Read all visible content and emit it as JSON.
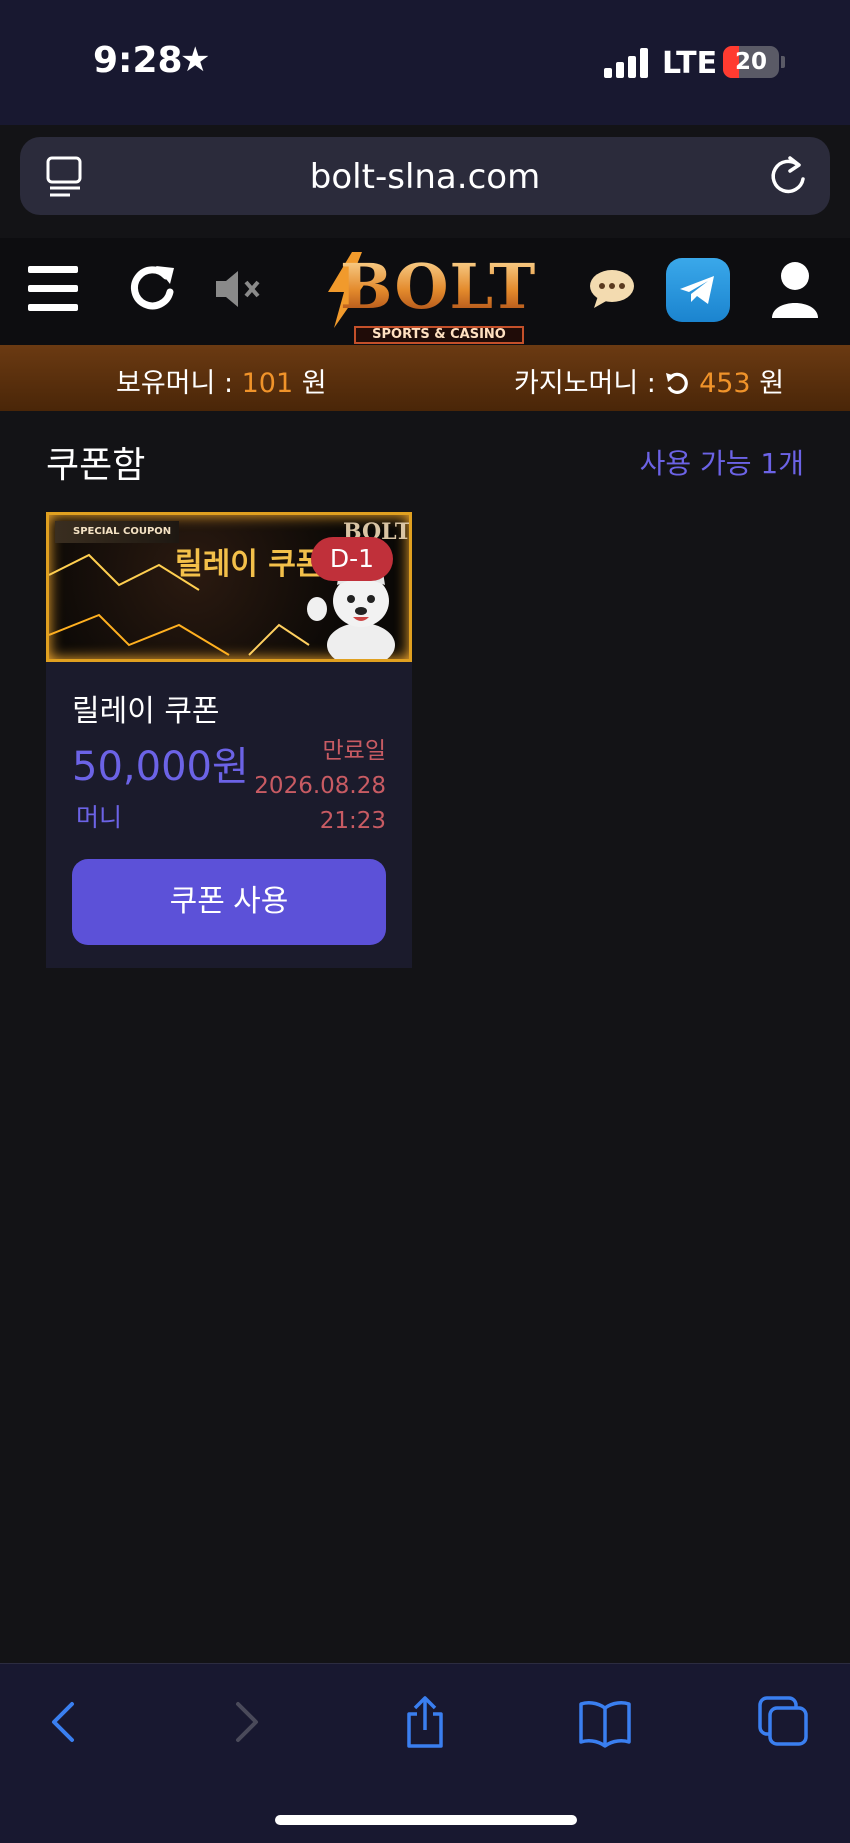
{
  "status_bar": {
    "time": "9:28",
    "star": "★",
    "network": "LTE",
    "battery": "20"
  },
  "browser": {
    "url": "bolt-slna.com"
  },
  "header": {
    "logo_text": "BOLT",
    "logo_subtitle": "SPORTS & CASINO",
    "icons": [
      "menu-icon",
      "refresh-icon",
      "mute-icon",
      "chat-icon",
      "telegram-icon",
      "user-icon"
    ]
  },
  "balance": {
    "money_label": "보유머니 : ",
    "money_value": "101",
    "money_unit": " 원",
    "casino_label": "카지노머니 : ",
    "casino_value": "453",
    "casino_unit": " 원"
  },
  "coupons": {
    "title": "쿠폰함",
    "available": "사용 가능 1개",
    "items": [
      {
        "banner_tag": "SPECIAL COUPON",
        "banner_title": "릴레이 쿠폰",
        "banner_brand": "BOLT",
        "d_badge": "D-1",
        "name": "릴레이 쿠폰",
        "amount": "50,000원",
        "type": "머니",
        "expiry_label": "만료일",
        "expiry_date": "2026.08.28",
        "expiry_time": "21:23",
        "use_button": "쿠폰 사용"
      }
    ]
  },
  "colors": {
    "accent": "#5c51d8",
    "balance_bar": "#6b3a12",
    "money_amount": "#f0932a",
    "expiry": "#c85b63"
  }
}
